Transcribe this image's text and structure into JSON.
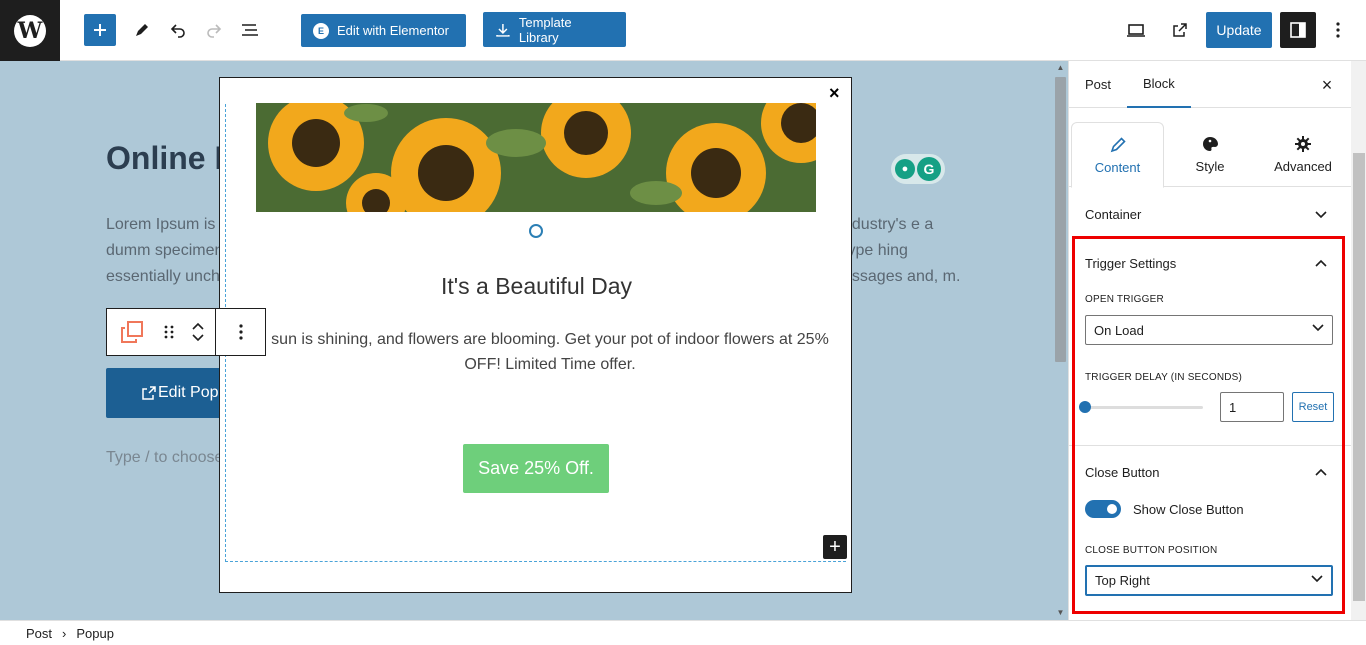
{
  "toolbar": {
    "wp_logo_letter": "W",
    "edit_elementor_label": "Edit with Elementor",
    "elementor_badge": "E",
    "template_library_label": "Template Library",
    "update_label": "Update"
  },
  "canvas": {
    "post_title": "Online I",
    "lorem_left": "Lorem Ipsum is standard dumm specimen book. essentially unch",
    "lorem_right": "ndustry's e a type hing assages and, m.",
    "edit_popup_label": "Edit Pop",
    "type_hint": "Type / to choose",
    "grammarly_letter": "G"
  },
  "popup": {
    "close_symbol": "×",
    "heading": "It's a Beautiful Day",
    "text": "sun is shining, and flowers are blooming. Get your pot of indoor flowers at 25% OFF! Limited Time offer.",
    "cta_label": "Save 25% Off.",
    "add_symbol": "+"
  },
  "sidebar": {
    "tabs": [
      {
        "label": "Post",
        "active": false
      },
      {
        "label": "Block",
        "active": true
      }
    ],
    "close_symbol": "×",
    "sub_tabs": [
      {
        "label": "Content",
        "icon": "pencil-icon",
        "active": true
      },
      {
        "label": "Style",
        "icon": "palette-icon",
        "active": false
      },
      {
        "label": "Advanced",
        "icon": "gear-icon",
        "active": false
      }
    ],
    "container_label": "Container",
    "trigger_settings": {
      "title": "Trigger Settings",
      "open_trigger_label": "OPEN TRIGGER",
      "open_trigger_value": "On Load",
      "delay_label": "TRIGGER DELAY (IN SECONDS)",
      "delay_value": "1",
      "delay_slider_fraction": 0.0,
      "reset_label": "Reset"
    },
    "close_button": {
      "title": "Close Button",
      "show_label": "Show Close Button",
      "show_enabled": true,
      "position_label": "CLOSE BUTTON POSITION",
      "position_value": "Top Right"
    }
  },
  "footer": {
    "breadcrumb": [
      "Post",
      "Popup"
    ],
    "separator": "›"
  },
  "colors": {
    "accent": "#2271b1",
    "canvas_bg": "#aec8d7",
    "cta_green": "#6ecf7b",
    "highlight_red": "#e00000"
  }
}
